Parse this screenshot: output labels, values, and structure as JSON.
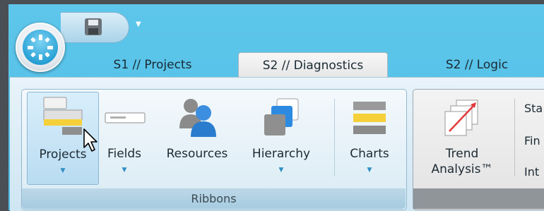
{
  "tabs": [
    {
      "label": "S1 // Projects",
      "active": false
    },
    {
      "label": "S2 // Diagnostics",
      "active": true
    },
    {
      "label": "S2 // Logic",
      "active": false
    }
  ],
  "ribbon": {
    "group_label": "Ribbons",
    "buttons": [
      {
        "label": "Projects",
        "icon": "projects-icon",
        "has_dropdown": true,
        "selected": true
      },
      {
        "label": "Fields",
        "icon": "fields-icon",
        "has_dropdown": true
      },
      {
        "label": "Resources",
        "icon": "resources-icon",
        "has_dropdown": false
      },
      {
        "label": "Hierarchy",
        "icon": "hierarchy-icon",
        "has_dropdown": true
      },
      {
        "label": "Charts",
        "icon": "charts-icon",
        "has_dropdown": true
      }
    ]
  },
  "analysis": {
    "trend_line1": "Trend",
    "trend_line2": "Analysis™",
    "side_items": [
      "Sta",
      "Fin",
      "Int"
    ]
  },
  "colors": {
    "accent": "#4fbde6",
    "highlight_bar": "#f5d03b",
    "icon_blue": "#2a86d0",
    "trend_red": "#e23a3a"
  }
}
